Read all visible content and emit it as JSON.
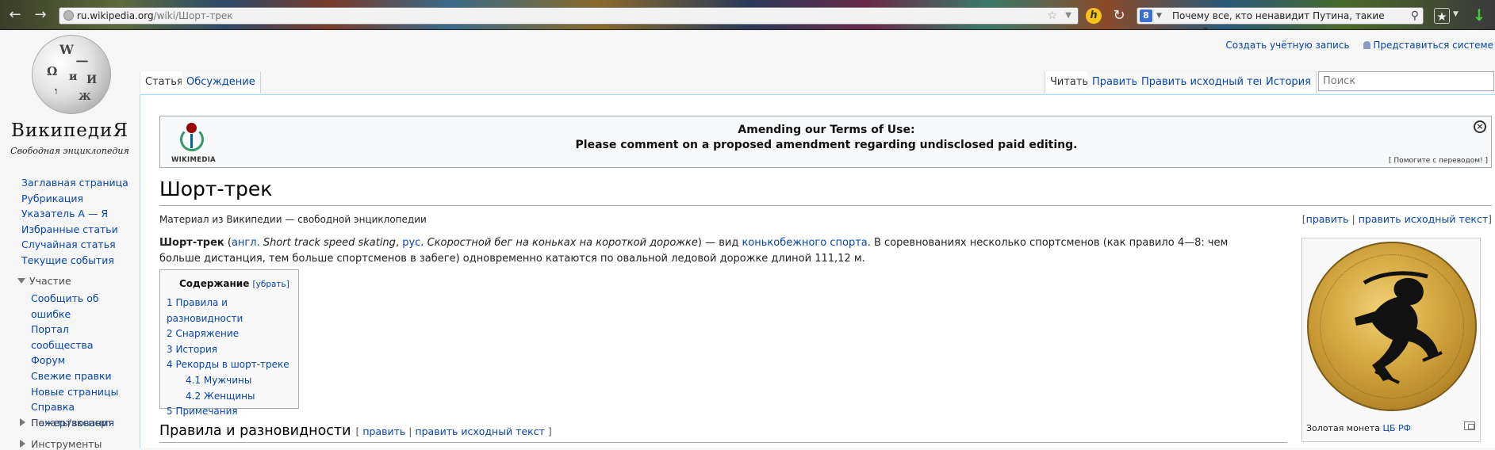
{
  "browser": {
    "url_host": "ru.wikipedia.org",
    "url_path": "/wiki/Шорт-трек",
    "search_text": "Почему все, кто ненавидит Путина, такие тупые?",
    "search_engine_glyph": "8"
  },
  "personal": {
    "create_account": "Создать учётную запись",
    "login": "Представиться системе"
  },
  "logo": {
    "title": "ВикипедиЯ",
    "slogan": "Свободная энциклопедия"
  },
  "sidebar": {
    "nav": [
      "Заглавная страница",
      "Рубрикация",
      "Указатель А — Я",
      "Избранные статьи",
      "Случайная статья",
      "Текущие события"
    ],
    "participate_heading": "Участие",
    "participate": [
      "Сообщить об ошибке",
      "Портал сообщества",
      "Форум",
      "Свежие правки",
      "Новые страницы",
      "Справка",
      "Пожертвования"
    ],
    "print_heading": "Печать/экспорт",
    "tools_heading": "Инструменты"
  },
  "tabs": {
    "article": "Статья",
    "talk": "Обсуждение",
    "read": "Читать",
    "edit": "Править",
    "edit_source": "Править исходный текст",
    "history": "История",
    "search_placeholder": "Поиск"
  },
  "banner": {
    "logo_text": "WIKIMEDIA",
    "line1": "Amending our Terms of Use:",
    "line2": "Please comment on a proposed amendment regarding undisclosed paid editing.",
    "translate": "[ Помогите с переводом! ]"
  },
  "article": {
    "title": "Шорт-трек",
    "site_sub": "Материал из Википедии — свободной энциклопедии",
    "edit_open": "[",
    "edit": "править",
    "edit_sep": " | ",
    "edit_source": "править исходный текст",
    "edit_close": "]",
    "lead": {
      "term": "Шорт-трек",
      "paren_open": " (",
      "lang_en": "англ.",
      "en_term": " Short track speed skating",
      "comma": ", ",
      "lang_ru": "рус.",
      "ru_term": " Скоростной бег на коньках на короткой дорожке",
      "paren_close": ") — вид ",
      "sport_link": "конькобежного спорта",
      "rest": ". В соревнованиях несколько спортсменов (как правило 4—8: чем больше дистанция, тем больше спортсменов в забеге) одновременно катаются по овальной ледовой дорожке длиной 111,12 м."
    },
    "toc": {
      "title": "Содержание",
      "hide": "[убрать]",
      "items": [
        {
          "label": "1 Правила и разновидности"
        },
        {
          "label": "2 Снаряжение"
        },
        {
          "label": "3 История"
        },
        {
          "label": "4 Рекорды в шорт-треке"
        },
        {
          "label": "4.1 Мужчины"
        },
        {
          "label": "4.2 Женщины"
        },
        {
          "label": "5 Примечания"
        }
      ]
    },
    "section1": {
      "title": "Правила и разновидности"
    },
    "thumb": {
      "caption_text": "Золотая монета ",
      "caption_link": "ЦБ РФ"
    }
  },
  "colors": {
    "link": "#0645ad",
    "banner_border": "#a2a9b1",
    "tab_border": "#a7d7f9"
  }
}
